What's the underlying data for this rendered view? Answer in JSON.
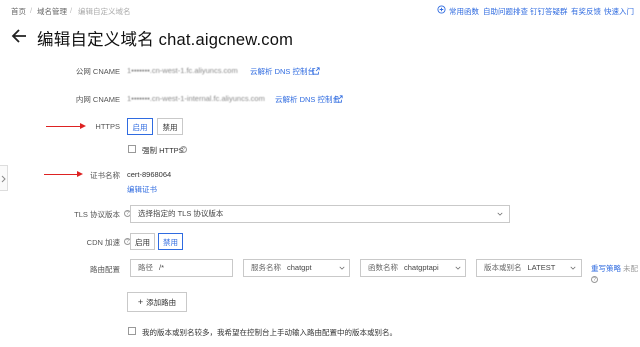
{
  "breadcrumb": [
    "首页",
    "域名管理",
    "编辑自定义域名"
  ],
  "top_links": [
    "常用函数",
    "自助问题排查",
    "钉钉答疑群",
    "有奖反馈",
    "快速入门"
  ],
  "page_title": "编辑自定义域名 chat.aigcnew.com",
  "public_cname": {
    "label": "公网 CNAME",
    "value_masked": "1▪▪▪▪▪▪▪.cn-west-1.fc.aliyuncs.com",
    "link": "云解析 DNS 控制台"
  },
  "private_cname": {
    "label": "内网 CNAME",
    "value_masked": "1▪▪▪▪▪▪▪.cn-west-1-internal.fc.aliyuncs.com",
    "link": "云解析 DNS 控制台"
  },
  "https": {
    "label": "HTTPS",
    "enable": "启用",
    "disable": "禁用",
    "force_label": "强制 HTTPS"
  },
  "cert": {
    "label": "证书名称",
    "value": "cert-8968064",
    "edit_link": "编辑证书"
  },
  "tls": {
    "label": "TLS 协议版本",
    "placeholder": "选择指定的 TLS 协议版本"
  },
  "cdn": {
    "label": "CDN 加速",
    "enable": "启用",
    "disable": "禁用"
  },
  "route": {
    "label": "路由配置",
    "path_prefix": "路径",
    "path_value": "/*",
    "service_prefix": "服务名称",
    "service_value": "chatgpt",
    "function_prefix": "函数名称",
    "function_value": "chatgptapi",
    "version_prefix": "版本或别名",
    "version_value": "LATEST",
    "rewrite_link": "重写策略",
    "rewrite_status": "未配",
    "add_button": "添加路由"
  },
  "footer_checkbox": "我的版本或别名较多，我希望在控制台上手动输入路由配置中的版本或别名。",
  "colors": {
    "accent": "#2f6be0",
    "annotation_arrow": "#dd2222"
  }
}
